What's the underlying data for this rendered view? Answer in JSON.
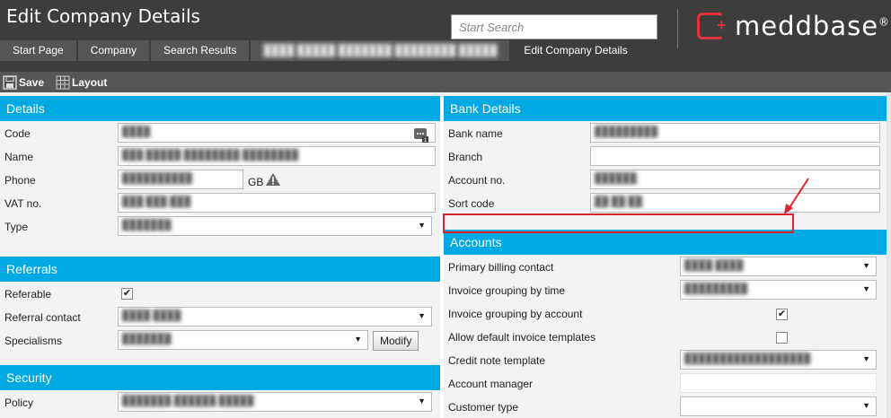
{
  "app": {
    "title": "Edit Company Details",
    "search_placeholder": "Start Search",
    "logo_text": "meddbase",
    "logo_mark": "®"
  },
  "breadcrumbs": [
    "Start Page",
    "Company",
    "Search Results",
    "████ █████ ███████ ████████ █████",
    "Edit Company Details"
  ],
  "toolbar": {
    "save_label": "Save",
    "layout_label": "Layout"
  },
  "details": {
    "title": "Details",
    "code_label": "Code",
    "code_value": "████",
    "name_label": "Name",
    "name_value": "███ █████ ████████ ████████",
    "phone_label": "Phone",
    "phone_value": "██████████",
    "phone_region": "GB",
    "vat_label": "VAT no.",
    "vat_value": "███ ███ ███",
    "type_label": "Type",
    "type_value": "███████"
  },
  "referrals": {
    "title": "Referrals",
    "referable_label": "Referable",
    "referral_contact_label": "Referral contact",
    "referral_contact_value": "████ ████",
    "specialisms_label": "Specialisms",
    "specialisms_value": "███████",
    "modify_label": "Modify"
  },
  "security": {
    "title": "Security",
    "policy_label": "Policy",
    "policy_value": "███████ ██████ █████"
  },
  "bank": {
    "title": "Bank Details",
    "bank_name_label": "Bank name",
    "bank_name_value": "█████████",
    "branch_label": "Branch",
    "branch_value": "",
    "account_label": "Account no.",
    "account_value": "██████",
    "sort_label": "Sort code",
    "sort_value": "██ ██ ██"
  },
  "accounts": {
    "title": "Accounts",
    "primary_billing_label": "Primary billing contact",
    "primary_billing_value": "████ ████",
    "grouping_time_label": "Invoice grouping by time",
    "grouping_time_value": "█████████",
    "grouping_account_label": "Invoice grouping by account",
    "default_templates_label": "Allow default invoice templates",
    "credit_note_label": "Credit note template",
    "credit_note_value": "██████████████████",
    "manager_label": "Account manager",
    "manager_value": "",
    "customer_type_label": "Customer type",
    "customer_type_value": ""
  },
  "colors": {
    "section_header": "#00a9e3",
    "highlight": "#d9262e",
    "header_bg": "#3d3d3d",
    "brand": "#e0323b"
  }
}
